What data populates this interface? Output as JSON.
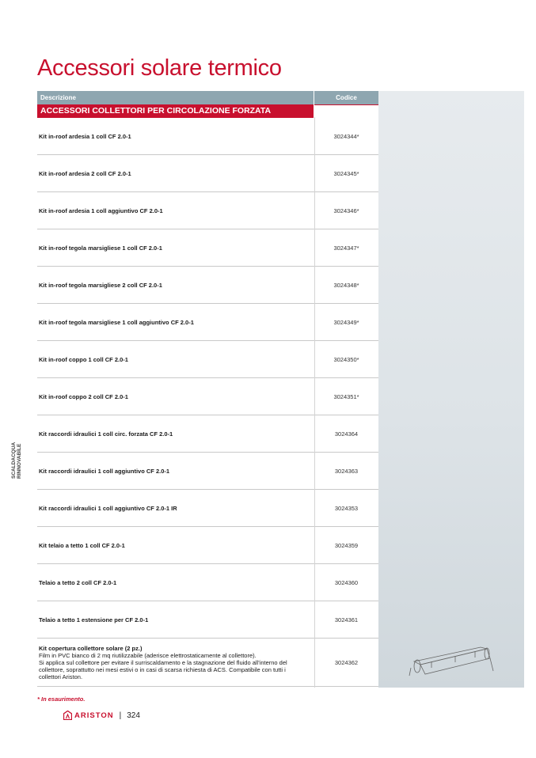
{
  "title": "Accessori solare termico",
  "table": {
    "headers": {
      "description": "Descrizione",
      "code": "Codice"
    },
    "section": "ACCESSORI COLLETTORI PER CIRCOLAZIONE FORZATA",
    "rows": [
      {
        "description": "Kit in-roof ardesia 1 coll CF 2.0-1",
        "code": "3024344*"
      },
      {
        "description": "Kit in-roof ardesia 2 coll CF 2.0-1",
        "code": "3024345*"
      },
      {
        "description": "Kit in-roof ardesia 1 coll aggiuntivo CF 2.0-1",
        "code": "3024346*"
      },
      {
        "description": "Kit in-roof tegola marsigliese 1 coll CF 2.0-1",
        "code": "3024347*"
      },
      {
        "description": "Kit in-roof tegola marsigliese 2 coll CF 2.0-1",
        "code": "3024348*"
      },
      {
        "description": "Kit in-roof tegola marsigliese 1 coll aggiuntivo CF 2.0-1",
        "code": "3024349*"
      },
      {
        "description": "Kit in-roof coppo 1 coll CF 2.0-1",
        "code": "3024350*"
      },
      {
        "description": "Kit in-roof coppo 2 coll CF 2.0-1",
        "code": "3024351*"
      },
      {
        "description": "Kit raccordi idraulici 1 coll circ. forzata CF 2.0-1",
        "code": "3024364"
      },
      {
        "description": "Kit raccordi idraulici 1 coll aggiuntivo CF 2.0-1",
        "code": "3024363"
      },
      {
        "description": "Kit raccordi idraulici 1 coll aggiuntivo CF 2.0-1 IR",
        "code": "3024353"
      },
      {
        "description": "Kit telaio a tetto 1 coll CF 2.0-1",
        "code": "3024359"
      },
      {
        "description": "Telaio a tetto 2 coll CF 2.0-1",
        "code": "3024360"
      },
      {
        "description": "Telaio a tetto 1 estensione per CF 2.0-1",
        "code": "3024361"
      }
    ],
    "last_row": {
      "name": "Kit copertura collettore solare (2 pz.)",
      "line1": "Film in PVC bianco di 2 mq riutilizzabile (aderisce elettrostaticamente al collettore).",
      "line2": "Si applica sul collettore per evitare il surriscaldamento e la stagnazione del fluido all'interno del",
      "line3": "collettore, soprattutto nei mesi estivi o in casi di scarsa richiesta di ACS. Compatibile con tutti i",
      "line4": "collettori Ariston.",
      "code": "3024362"
    }
  },
  "footnote": "* In esaurimento.",
  "sidebar": {
    "line1": "SCALDACQUA",
    "line2": "RINNOVABILE"
  },
  "footer": {
    "brand": "ARISTON",
    "separator": "|",
    "page": "324"
  },
  "colors": {
    "accent": "#c8102e",
    "header_bg": "#8ea6b0",
    "panel_bg": "#e0e6ea"
  }
}
